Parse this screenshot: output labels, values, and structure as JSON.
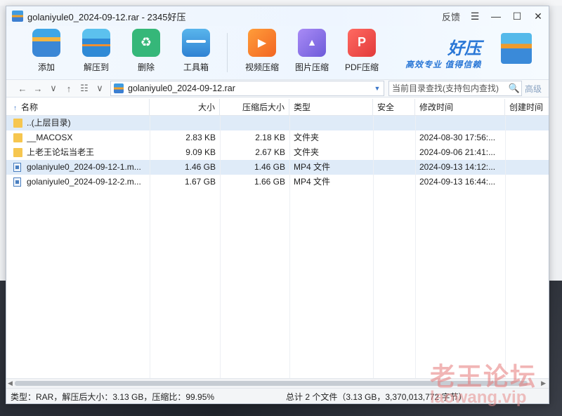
{
  "window": {
    "title": "golaniyule0_2024-09-12.rar - 2345好压",
    "feedback": "反馈",
    "menu_icon": "hamburger-icon",
    "minimize_icon": "minimize-icon",
    "maximize_icon": "maximize-icon",
    "close_icon": "close-icon"
  },
  "toolbar": {
    "items": [
      {
        "label": "添加",
        "icon": "add-archive-icon"
      },
      {
        "label": "解压到",
        "icon": "extract-icon"
      },
      {
        "label": "删除",
        "icon": "recycle-icon"
      },
      {
        "label": "工具箱",
        "icon": "toolbox-icon"
      },
      {
        "label": "视频压缩",
        "icon": "video-compress-icon"
      },
      {
        "label": "图片压缩",
        "icon": "image-compress-icon"
      },
      {
        "label": "PDF压缩",
        "icon": "pdf-compress-icon"
      }
    ],
    "brand_name": "好压",
    "brand_slogan": "高效专业  值得信赖"
  },
  "address": {
    "path": "golaniyule0_2024-09-12.rar",
    "search_placeholder": "当前目录查找(支持包内查找)",
    "advanced": "高级",
    "nav": {
      "back": "←",
      "forward": "→",
      "dropdown": "∨",
      "up": "↑",
      "view": "☷"
    }
  },
  "columns": {
    "name": "名称",
    "size": "大小",
    "packed": "压缩后大小",
    "type": "类型",
    "security": "安全",
    "modified": "修改时间",
    "created": "创建时间",
    "sort_indicator": "↑"
  },
  "rows": [
    {
      "name": "..(上层目录)",
      "size": "",
      "packed": "",
      "type": "",
      "modified": "",
      "kind": "folder",
      "selected": true
    },
    {
      "name": "__MACOSX",
      "size": "2.83 KB",
      "packed": "2.18 KB",
      "type": "文件夹",
      "modified": "2024-08-30 17:56:...",
      "kind": "folder",
      "selected": false
    },
    {
      "name": "上老王论坛当老王",
      "size": "9.09 KB",
      "packed": "2.67 KB",
      "type": "文件夹",
      "modified": "2024-09-06 21:41:...",
      "kind": "folder",
      "selected": false
    },
    {
      "name": "golaniyule0_2024-09-12-1.m...",
      "size": "1.46 GB",
      "packed": "1.46 GB",
      "type": "MP4 文件",
      "modified": "2024-09-13 14:12:...",
      "kind": "file",
      "selected": true
    },
    {
      "name": "golaniyule0_2024-09-12-2.m...",
      "size": "1.67 GB",
      "packed": "1.66 GB",
      "type": "MP4 文件",
      "modified": "2024-09-13 16:44:...",
      "kind": "file",
      "selected": false
    }
  ],
  "status": {
    "left": "类型：RAR，解压后大小：3.13 GB，压缩比：99.95%",
    "right": "总计 2 个文件（3.13 GB，3,370,013,772 字节）"
  },
  "watermark": {
    "text": "老王论坛",
    "url": "laowang.vip"
  }
}
